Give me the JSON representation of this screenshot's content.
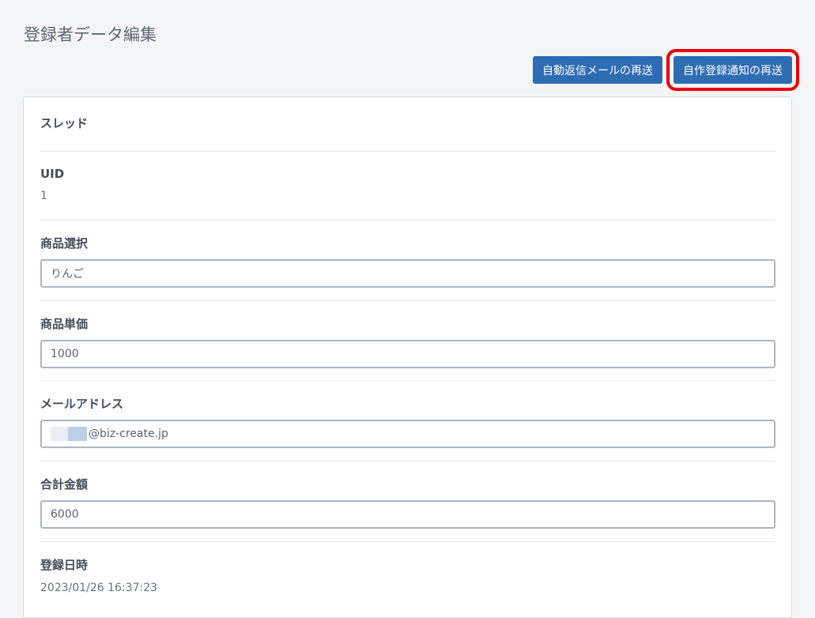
{
  "page": {
    "title": "登録者データ編集"
  },
  "toolbar": {
    "resend_autoreply_label": "自動返信メールの再送",
    "resend_notice_label": "自作登録通知の再送"
  },
  "form": {
    "thread": {
      "label": "スレッド"
    },
    "uid": {
      "label": "UID",
      "value": "1"
    },
    "product": {
      "label": "商品選択",
      "value": "りんご"
    },
    "unit_price": {
      "label": "商品単価",
      "value": "1000"
    },
    "email": {
      "label": "メールアドレス",
      "value_suffix": "@biz-create.jp"
    },
    "total": {
      "label": "合計金額",
      "value": "6000"
    },
    "registered_at": {
      "label": "登録日時",
      "value": "2023/01/26 16:37:23"
    }
  },
  "colors": {
    "primary_button": "#2f6db3",
    "highlight_box": "#ec0000"
  }
}
